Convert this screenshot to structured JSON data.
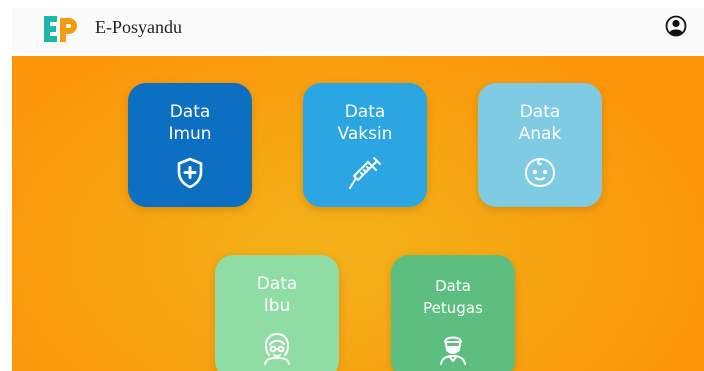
{
  "header": {
    "brand_mark": "EP",
    "title": "E-Posyandu",
    "account_icon": "account-circle-icon"
  },
  "menu": {
    "tiles": [
      {
        "label": "Data\nImun",
        "icon": "shield-plus-icon",
        "color": "#0c6fc2"
      },
      {
        "label": "Data\nVaksin",
        "icon": "syringe-icon",
        "color": "#2ba6e2"
      },
      {
        "label": "Data\nAnak",
        "icon": "baby-face-icon",
        "color": "#7ecbe3"
      },
      {
        "label": "Data\nIbu",
        "icon": "mother-icon",
        "color": "#8fdca5"
      },
      {
        "label": "Data\nPetugas",
        "icon": "health-worker-icon",
        "color": "#5cbf80"
      }
    ]
  },
  "colors": {
    "background": "#f6a713",
    "logo_e": "#1db8a8",
    "logo_p": "#f39c12"
  }
}
